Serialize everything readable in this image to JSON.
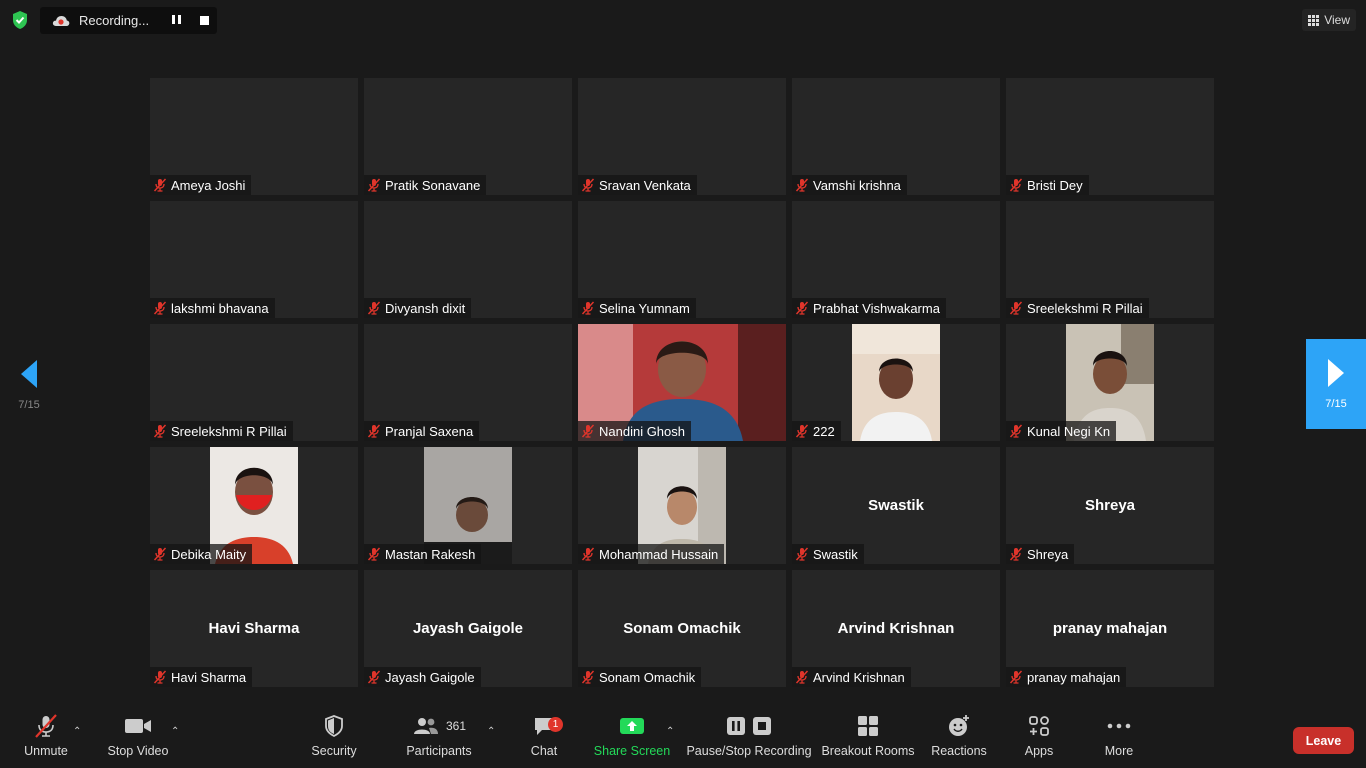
{
  "top": {
    "recording_label": "Recording...",
    "view_label": "View"
  },
  "nav": {
    "left_page": "7/15",
    "right_page": "7/15"
  },
  "tiles": [
    {
      "name": "Ameya Joshi",
      "display": "",
      "video": false
    },
    {
      "name": "Pratik Sonavane",
      "display": "",
      "video": false
    },
    {
      "name": "Sravan Venkata",
      "display": "",
      "video": false
    },
    {
      "name": "Vamshi krishna",
      "display": "",
      "video": false
    },
    {
      "name": "Bristi Dey",
      "display": "",
      "video": false
    },
    {
      "name": "lakshmi bhavana",
      "display": "",
      "video": false
    },
    {
      "name": "Divyansh dixit",
      "display": "",
      "video": false
    },
    {
      "name": "Selina Yumnam",
      "display": "",
      "video": false
    },
    {
      "name": "Prabhat Vishwakarma",
      "display": "",
      "video": false
    },
    {
      "name": "Sreelekshmi R Pillai",
      "display": "",
      "video": false
    },
    {
      "name": "Sreelekshmi R Pillai",
      "display": "",
      "video": false
    },
    {
      "name": "Pranjal Saxena",
      "display": "",
      "video": false
    },
    {
      "name": "Nandini Ghosh",
      "display": "",
      "video": true
    },
    {
      "name": "222",
      "display": "",
      "video": true
    },
    {
      "name": "Kunal Negi Kn",
      "display": "",
      "video": true
    },
    {
      "name": "Debika Maity",
      "display": "",
      "video": true
    },
    {
      "name": "Mastan Rakesh",
      "display": "",
      "video": true
    },
    {
      "name": "Mohammad Hussain",
      "display": "",
      "video": true
    },
    {
      "name": "Swastik",
      "display": "Swastik",
      "video": false
    },
    {
      "name": "Shreya",
      "display": "Shreya",
      "video": false
    },
    {
      "name": "Havi Sharma",
      "display": "Havi Sharma",
      "video": false
    },
    {
      "name": "Jayash Gaigole",
      "display": "Jayash Gaigole",
      "video": false
    },
    {
      "name": "Sonam Omachik",
      "display": "Sonam Omachik",
      "video": false
    },
    {
      "name": "Arvind Krishnan",
      "display": "Arvind Krishnan",
      "video": false
    },
    {
      "name": "pranay mahajan",
      "display": "pranay mahajan",
      "video": false
    }
  ],
  "toolbar": {
    "unmute": "Unmute",
    "stop_video": "Stop Video",
    "security": "Security",
    "participants": "Participants",
    "participants_count": "361",
    "chat": "Chat",
    "chat_badge": "1",
    "share_screen": "Share Screen",
    "pause_stop_recording": "Pause/Stop Recording",
    "breakout_rooms": "Breakout Rooms",
    "reactions": "Reactions",
    "apps": "Apps",
    "more": "More",
    "leave": "Leave"
  },
  "colors": {
    "background": "#1a1a1a",
    "tile": "#262626",
    "accent_blue": "#2da4f7",
    "share_green": "#23d959",
    "leave_red": "#c8302a",
    "muted_red": "#e0352b"
  }
}
